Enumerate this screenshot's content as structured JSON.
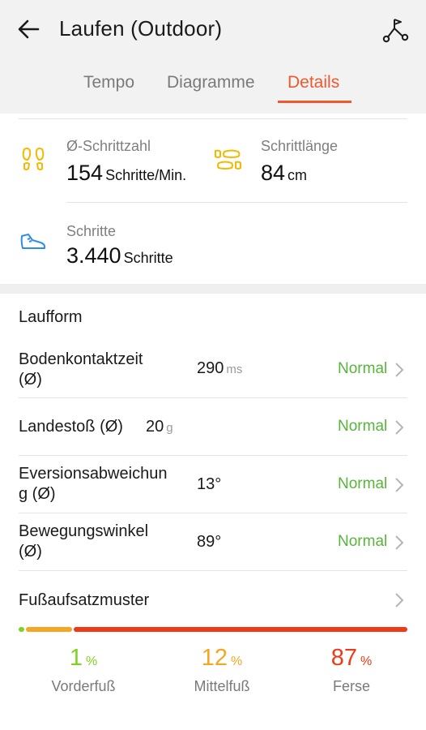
{
  "header": {
    "title": "Laufen (Outdoor)",
    "back_icon": "arrow-left-icon",
    "route_icon": "route-icon"
  },
  "tabs": [
    {
      "label": "Tempo",
      "selected": false
    },
    {
      "label": "Diagramme",
      "selected": false
    },
    {
      "label": "Details",
      "selected": true
    }
  ],
  "stats": {
    "cadence": {
      "label": "Ø-Schrittzahl",
      "value": "154",
      "unit": "Schritte/Min.",
      "icon": "footprints-icon"
    },
    "stride": {
      "label": "Schrittlänge",
      "value": "84",
      "unit": "cm",
      "icon": "stride-icon"
    },
    "steps": {
      "label": "Schritte",
      "value": "3.440",
      "unit": "Schritte",
      "icon": "running-shoe-icon"
    }
  },
  "running_form": {
    "title": "Laufform",
    "rows": [
      {
        "label_line1": "Bodenkontaktzeit",
        "label_line2": "(Ø)",
        "value": "290",
        "unit": "ms",
        "status": "Normal"
      },
      {
        "label_line1": "Landestoß (Ø)",
        "label_line2": "",
        "value": "20",
        "unit": "g",
        "status": "Normal"
      },
      {
        "label_line1": "Eversionsabweichun",
        "label_line2": "g (Ø)",
        "value": "13°",
        "unit": "",
        "status": "Normal"
      },
      {
        "label_line1": "Bewegungswinkel",
        "label_line2": "(Ø)",
        "value": "89°",
        "unit": "",
        "status": "Normal"
      }
    ]
  },
  "foot_strike": {
    "title": "Fußaufsatzmuster",
    "segments": [
      {
        "name": "Vorderfuß",
        "value": "1",
        "unit": "%",
        "fraction": 0.01,
        "color": "#7ed321"
      },
      {
        "name": "Mittelfuß",
        "value": "12",
        "unit": "%",
        "fraction": 0.12,
        "color": "#f5a623"
      },
      {
        "name": "Ferse",
        "value": "87",
        "unit": "%",
        "fraction": 0.87,
        "color": "#f03a17"
      }
    ]
  },
  "colors": {
    "accent": "#f0582d",
    "normal_status": "#58b43a",
    "icon_yellow": "#f5b800",
    "icon_blue": "#2e8de6"
  }
}
